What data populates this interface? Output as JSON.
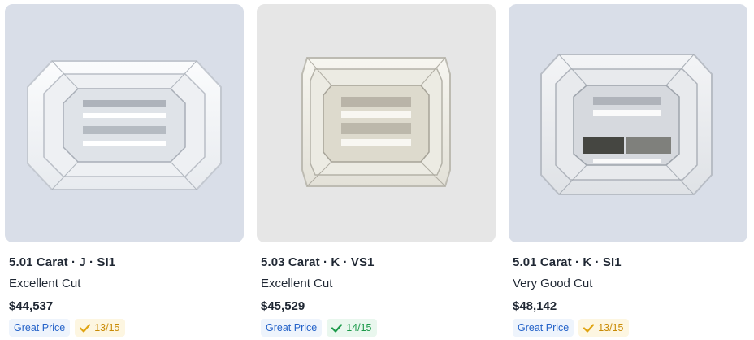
{
  "cards": [
    {
      "title": "5.01 Carat · J · SI1",
      "cut": "Excellent Cut",
      "price": "$44,537",
      "price_badge": "Great Price",
      "score": "13/15",
      "score_color": "#c98b07",
      "image_bg": "#d9dee8",
      "image_alt": "Emerald cut diamond"
    },
    {
      "title": "5.03 Carat · K · VS1",
      "cut": "Excellent Cut",
      "price": "$45,529",
      "price_badge": "Great Price",
      "score": "14/15",
      "score_color": "#1c9a4a",
      "image_bg": "#e6e6e6",
      "image_alt": "Emerald cut diamond"
    },
    {
      "title": "5.01 Carat · K · SI1",
      "cut": "Very Good Cut",
      "price": "$48,142",
      "price_badge": "Great Price",
      "score": "13/15",
      "score_color": "#c98b07",
      "image_bg": "#d9dee8",
      "image_alt": "Emerald cut diamond"
    }
  ],
  "colors": {
    "text": "#1f2733",
    "great_price": "#2563c9"
  },
  "icons": {
    "score": "check-icon"
  }
}
